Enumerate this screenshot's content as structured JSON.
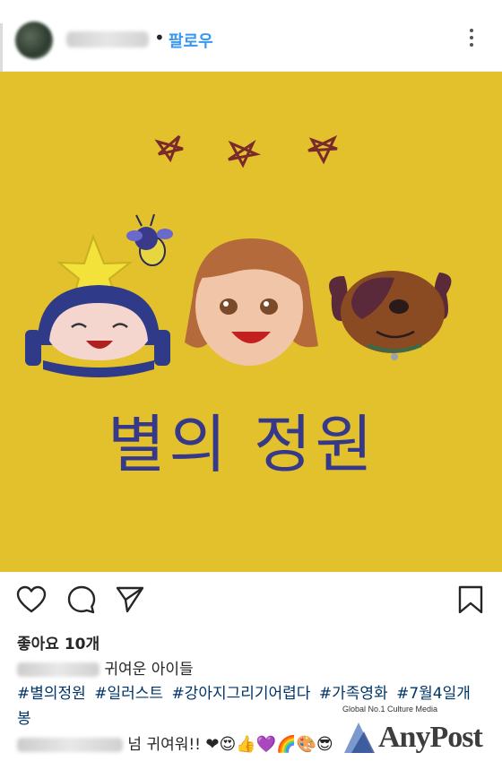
{
  "post": {
    "follow_label": "팔로우",
    "separator": "•"
  },
  "actions": {
    "like_icon": "heart-icon",
    "comment_icon": "comment-icon",
    "share_icon": "send-icon",
    "save_icon": "bookmark-icon"
  },
  "likes": {
    "label": "좋아요 10개"
  },
  "caption": {
    "text": "귀여운 아이들"
  },
  "hashtags": [
    "#별의정원",
    "#일러스트",
    "#강아지그리기어렵다",
    "#가족영화",
    "#7월4일개봉"
  ],
  "comment": {
    "text": "넘 귀여워!!",
    "emojis": "❤😍👍💜🌈🎨😎"
  },
  "illustration": {
    "title_text": "별의 정원"
  },
  "watermark": {
    "tagline": "Global No.1 Culture Media",
    "brand": "AnyPost"
  },
  "colors": {
    "follow": "#3897f0",
    "hashtag": "#003569",
    "photo_bg": "#e2c12c"
  }
}
